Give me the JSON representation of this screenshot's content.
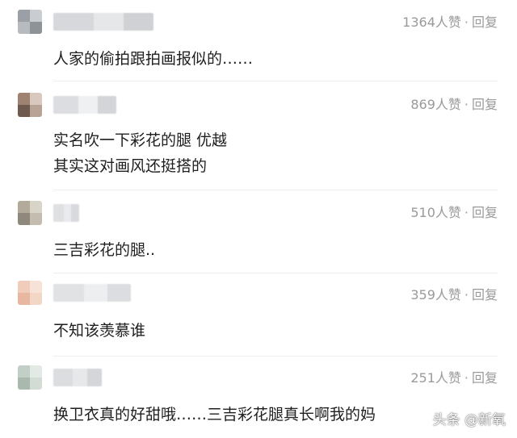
{
  "comments": [
    {
      "likes": "1364人赞",
      "sep": "·",
      "reply": "回复",
      "lines": [
        "人家的偷拍跟拍画报似的……"
      ],
      "avatar_colors": [
        "#9aa0a6",
        "#c9ccd0",
        "#b7bbbf",
        "#8e9398"
      ],
      "name_colors": [
        "#d6d8db",
        "#e6e7e9",
        "#cfd1d4"
      ]
    },
    {
      "likes": "869人赞",
      "sep": "·",
      "reply": "回复",
      "lines": [
        "实名吹一下彩花的腿 优越",
        "其实这对画风还挺搭的"
      ],
      "avatar_colors": [
        "#9e8373",
        "#d8c8be",
        "#6f5a4f",
        "#b8a396"
      ],
      "name_colors": [
        "#dcdde0",
        "#eef0f2",
        "#d3d5d8"
      ]
    },
    {
      "likes": "510人赞",
      "sep": "·",
      "reply": "回复",
      "lines": [
        "三吉彩花的腿.."
      ],
      "avatar_colors": [
        "#b2ab9c",
        "#d9d4c8",
        "#8f887c",
        "#c4bdaf"
      ],
      "name_colors": [
        "#dfe0e2",
        "#e9eaec",
        "#d9dadd"
      ]
    },
    {
      "likes": "359人赞",
      "sep": "·",
      "reply": "回复",
      "lines": [
        "不知该羡慕谁"
      ],
      "avatar_colors": [
        "#f0cdbb",
        "#f6e2d6",
        "#e8b79f",
        "#f2d6c6"
      ],
      "name_colors": [
        "#e1e2e4",
        "#eceef0",
        "#dcdde0"
      ]
    },
    {
      "likes": "251人赞",
      "sep": "·",
      "reply": "回复",
      "lines": [
        "换卫衣真的好甜哦……三吉彩花腿真长啊我的妈"
      ],
      "avatar_colors": [
        "#c2cfc6",
        "#e3e9e5",
        "#a9b9ad",
        "#d2dcd5"
      ],
      "name_colors": [
        "#dcdde0",
        "#e7e8ea",
        "#d4d6d9"
      ]
    }
  ],
  "watermark": "头条 @新氧"
}
